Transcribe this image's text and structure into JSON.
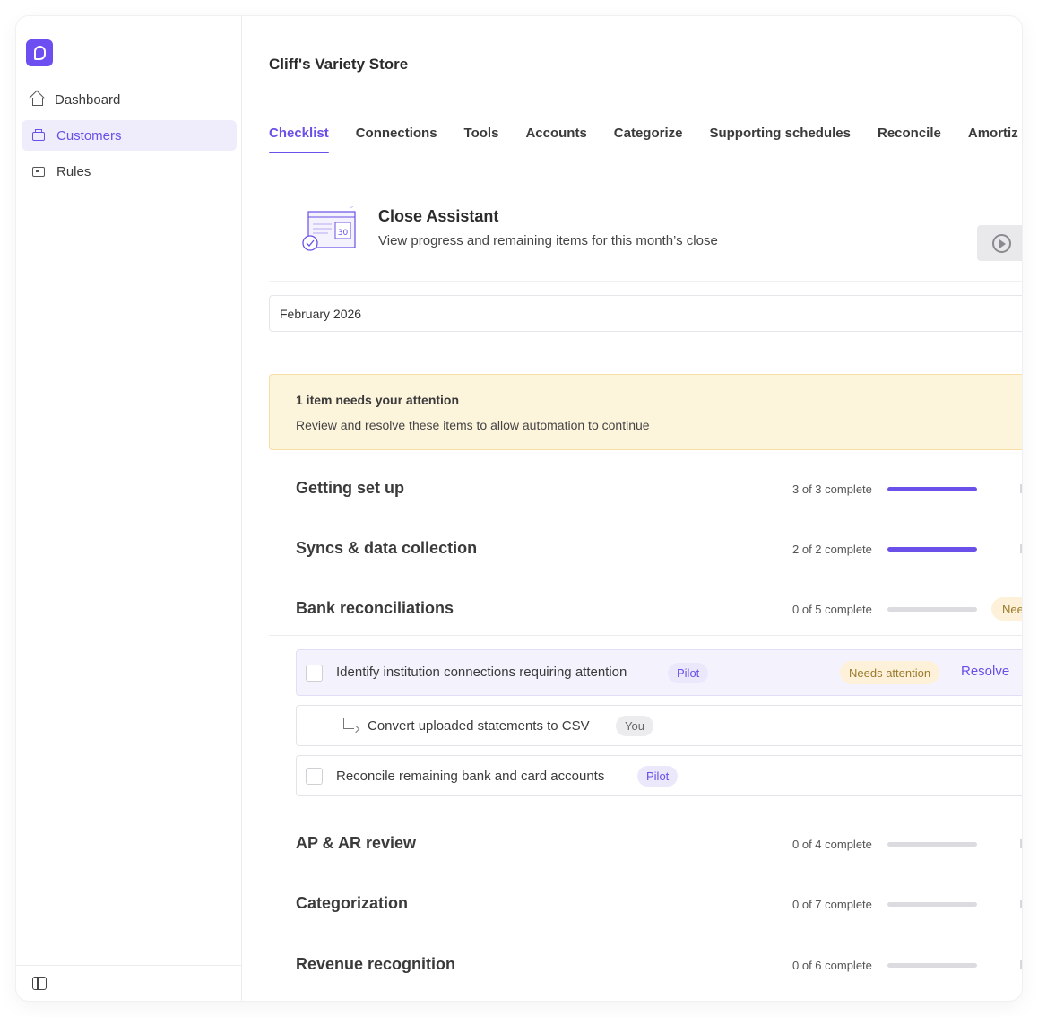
{
  "sidebar": {
    "logo": "p",
    "items": [
      {
        "label": "Dashboard",
        "icon": "home-icon",
        "active": false
      },
      {
        "label": "Customers",
        "icon": "customers-icon",
        "active": true
      },
      {
        "label": "Rules",
        "icon": "rules-icon",
        "active": false
      }
    ],
    "footer_icon": "sidebar-collapse-icon"
  },
  "header": {
    "title": "Cliff's Variety Store"
  },
  "tabs": [
    {
      "label": "Checklist",
      "active": true
    },
    {
      "label": "Connections"
    },
    {
      "label": "Tools"
    },
    {
      "label": "Accounts"
    },
    {
      "label": "Categorize"
    },
    {
      "label": "Supporting schedules"
    },
    {
      "label": "Reconcile"
    },
    {
      "label": "Amortiz"
    }
  ],
  "assistant": {
    "title": "Close Assistant",
    "subtitle": "View progress and remaining items for this month’s close",
    "illustration_date": "30",
    "video_icon": "play-circle-icon"
  },
  "month": {
    "value": "February 2026"
  },
  "alert": {
    "title": "1 item needs your attention",
    "message": "Review and resolve these items to allow automation to continue"
  },
  "sections": [
    {
      "title": "Getting set up",
      "count": "3 of 3 complete",
      "progress": 1.0
    },
    {
      "title": "Syncs & data collection",
      "count": "2 of 2 complete",
      "progress": 1.0
    },
    {
      "title": "Bank reconciliations",
      "count": "0 of 5 complete",
      "progress": 0.0,
      "badge": "Nee"
    },
    {
      "title": "AP & AR review",
      "count": "0 of 4 complete",
      "progress": 0.0
    },
    {
      "title": "Categorization",
      "count": "0 of 7 complete",
      "progress": 0.0
    },
    {
      "title": "Revenue recognition",
      "count": "0 of 6 complete",
      "progress": 0.0
    }
  ],
  "tasks": [
    {
      "label": "Identify institution connections requiring attention",
      "tag": "Pilot",
      "status": "Needs attention",
      "action": "Resolve"
    },
    {
      "label": "Convert uploaded statements to CSV",
      "tag": "You"
    },
    {
      "label": "Reconcile remaining bank and card accounts",
      "tag": "Pilot"
    }
  ],
  "colors": {
    "accent": "#6a4fe8",
    "alert_bg": "#fdf4dc",
    "warning_text": "#9a7a2c"
  }
}
